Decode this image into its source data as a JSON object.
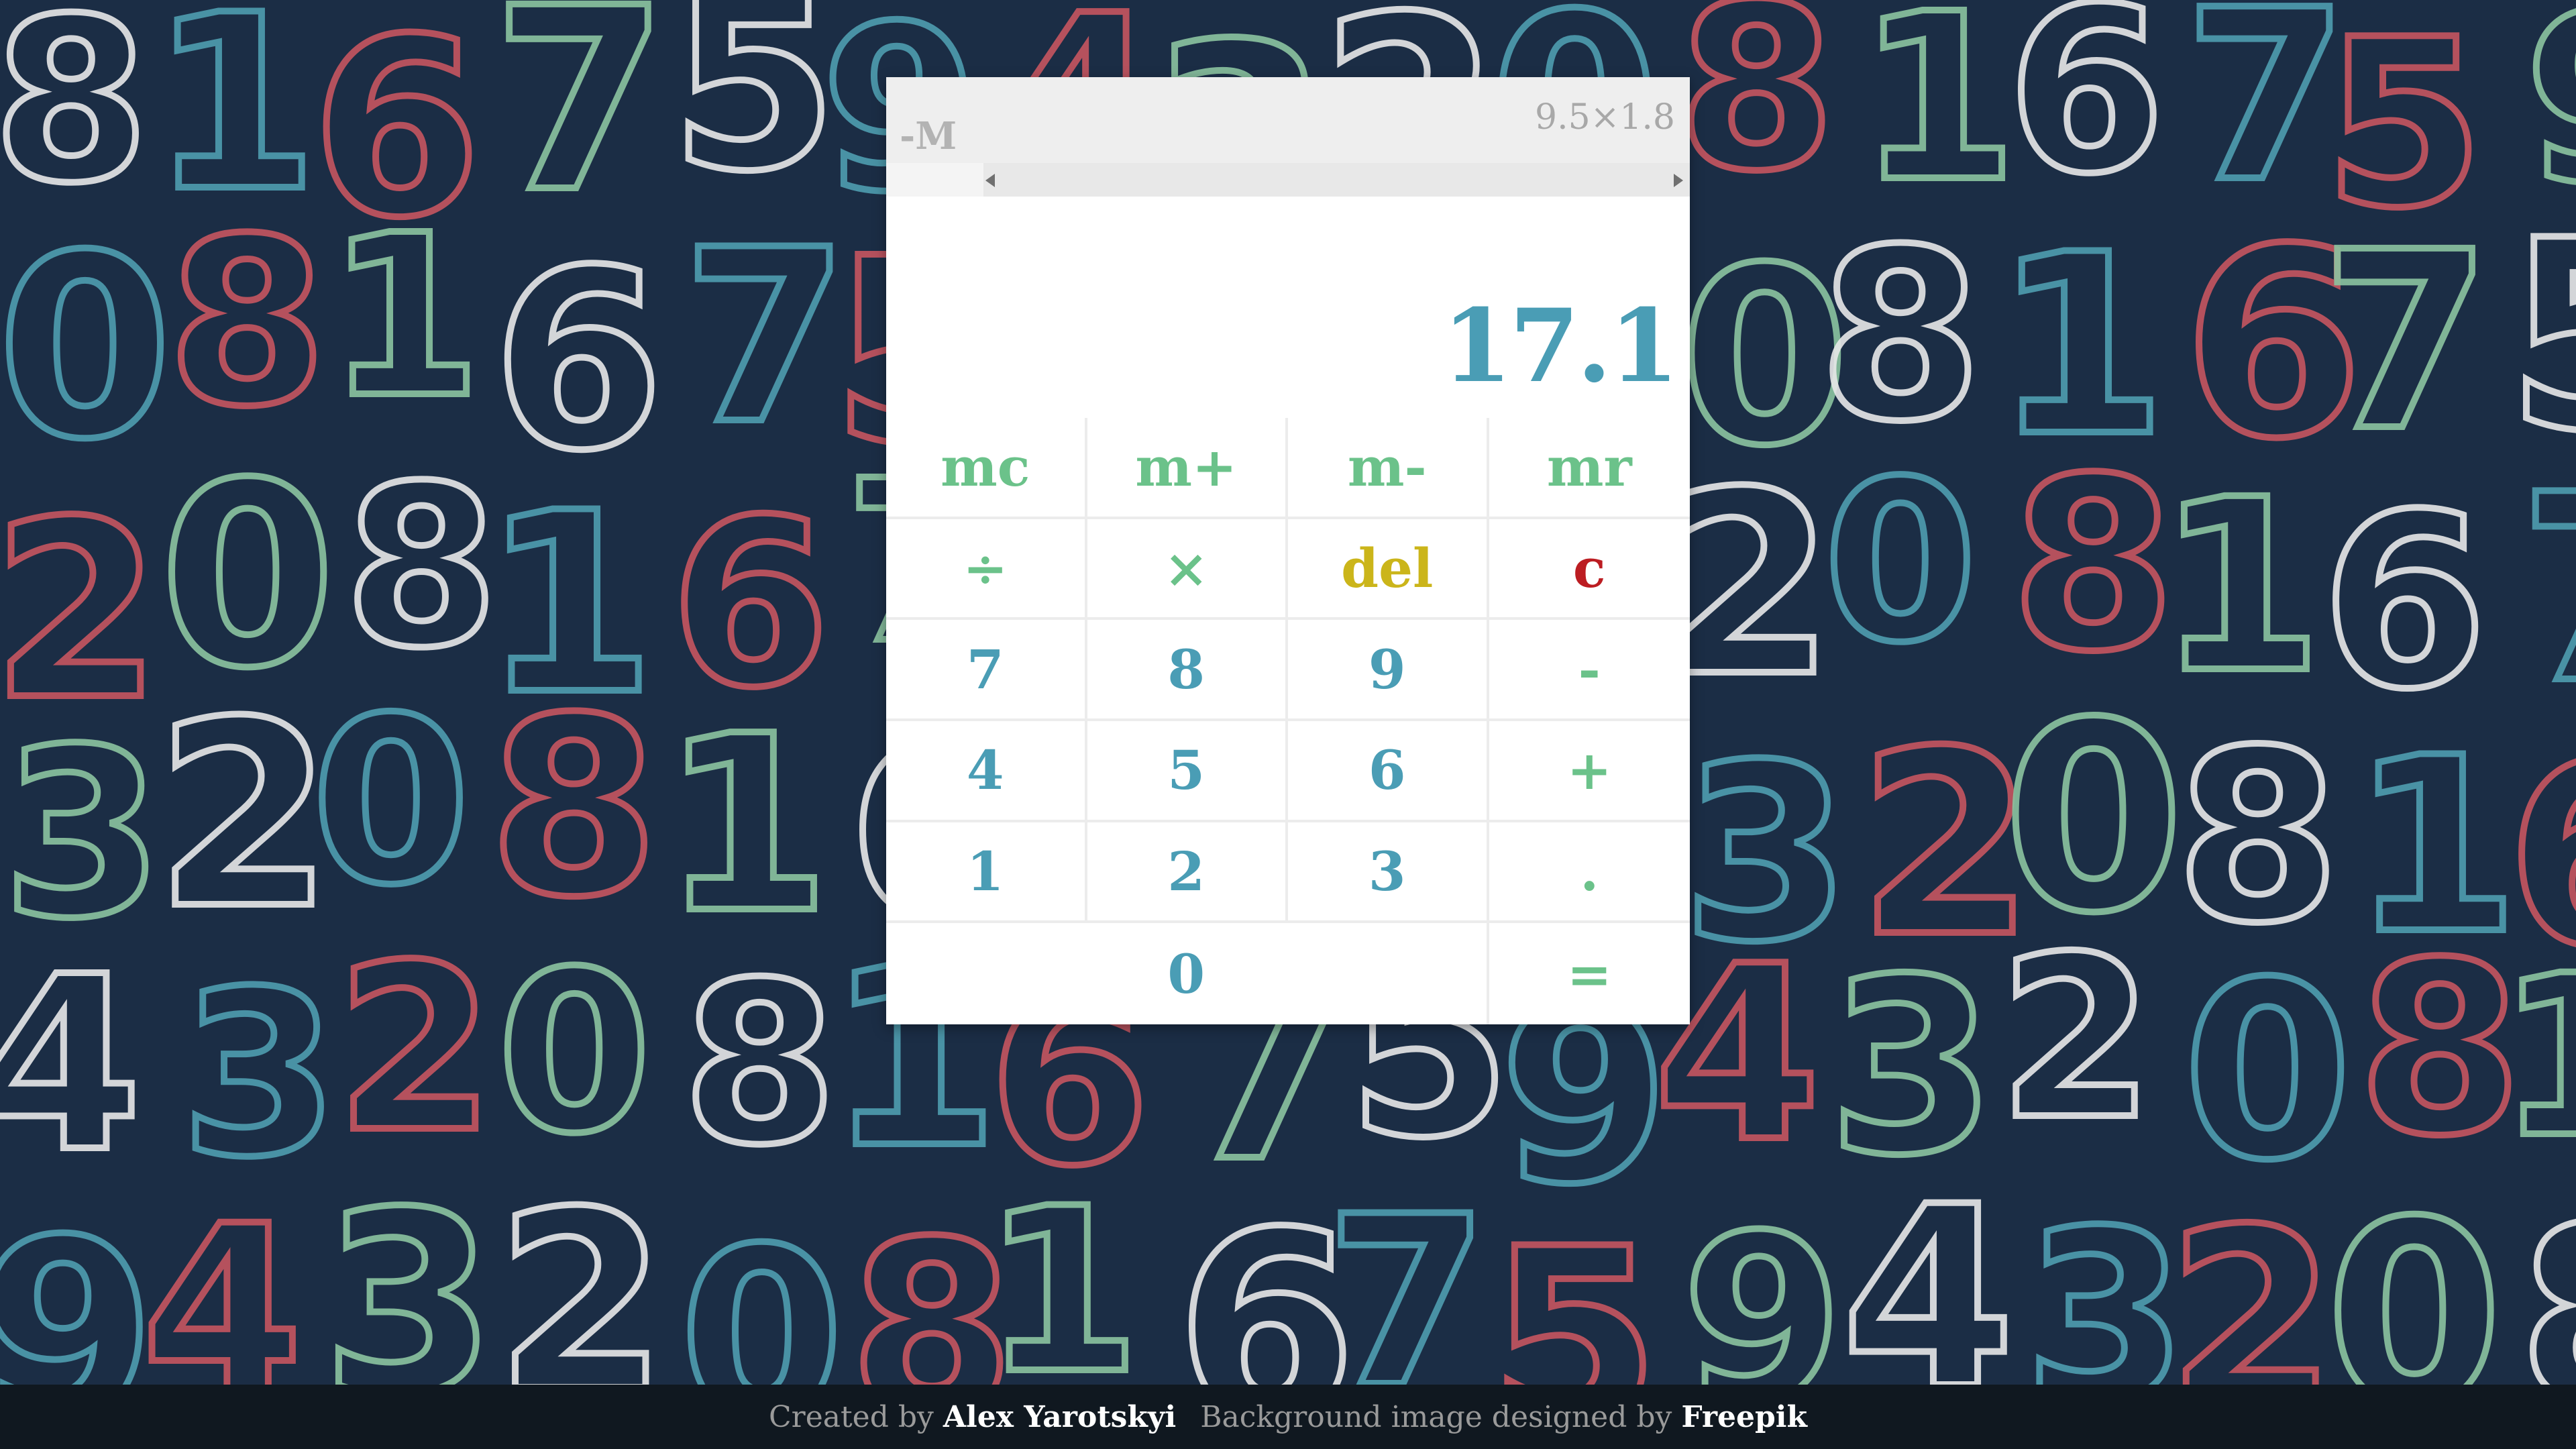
{
  "calculator": {
    "memory_indicator": "-M",
    "expression": "9.5×1.8",
    "display_value": "17.1",
    "keys": [
      {
        "label": "mc",
        "name": "memory-clear-button",
        "style": "green"
      },
      {
        "label": "m+",
        "name": "memory-add-button",
        "style": "green"
      },
      {
        "label": "m-",
        "name": "memory-subtract-button",
        "style": "green"
      },
      {
        "label": "mr",
        "name": "memory-recall-button",
        "style": "green"
      },
      {
        "label": "÷",
        "name": "divide-button",
        "style": "green"
      },
      {
        "label": "×",
        "name": "multiply-button",
        "style": "green"
      },
      {
        "label": "del",
        "name": "delete-button",
        "style": "yellow"
      },
      {
        "label": "c",
        "name": "clear-button",
        "style": "red"
      },
      {
        "label": "7",
        "name": "digit-7-button",
        "style": "blue"
      },
      {
        "label": "8",
        "name": "digit-8-button",
        "style": "blue"
      },
      {
        "label": "9",
        "name": "digit-9-button",
        "style": "blue"
      },
      {
        "label": "-",
        "name": "minus-button",
        "style": "green"
      },
      {
        "label": "4",
        "name": "digit-4-button",
        "style": "blue"
      },
      {
        "label": "5",
        "name": "digit-5-button",
        "style": "blue"
      },
      {
        "label": "6",
        "name": "digit-6-button",
        "style": "blue"
      },
      {
        "label": "+",
        "name": "plus-button",
        "style": "green"
      },
      {
        "label": "1",
        "name": "digit-1-button",
        "style": "blue"
      },
      {
        "label": "2",
        "name": "digit-2-button",
        "style": "blue"
      },
      {
        "label": "3",
        "name": "digit-3-button",
        "style": "blue"
      },
      {
        "label": ".",
        "name": "decimal-point-button",
        "style": "green"
      },
      {
        "label": "0",
        "name": "digit-0-button",
        "style": "blue"
      },
      {
        "label": "=",
        "name": "equals-button",
        "style": "green"
      }
    ]
  },
  "footer": {
    "created_by_prefix": "Created by",
    "author": "Alex Yarotskyi",
    "background_prefix": "Background image designed by",
    "background_credit": "Freepik"
  },
  "colors": {
    "background": "#1b2d45",
    "blue": "#4a9db5",
    "green": "#6bc28a",
    "yellow": "#cbb51a",
    "red": "#bc1d22",
    "pattern_white": "#e8e8e8",
    "pattern_blue": "#4f9db0",
    "pattern_red": "#c65660",
    "pattern_green": "#8cc4a0"
  }
}
